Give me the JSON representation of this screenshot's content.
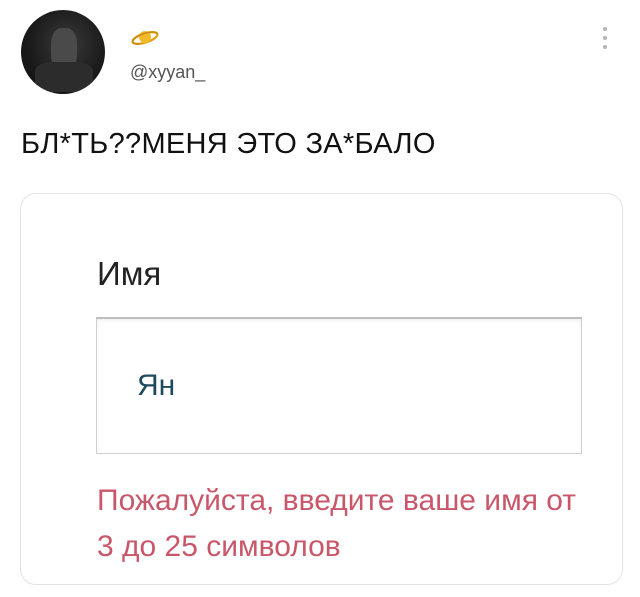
{
  "tweet": {
    "author": {
      "handle": "@xyyan_",
      "avatar_icon": "avatar-photo",
      "badge_icon": "planet-icon"
    },
    "more_icon": "vertical-dots-icon",
    "text": "БЛ*ТЬ??МЕНЯ ЭТО ЗА*БАЛО"
  },
  "form_card": {
    "label": "Имя",
    "input_value": "Ян",
    "error_message": "Пожалуйста, введите ваше имя от 3 до 25 символов",
    "error_color": "#c9576a"
  }
}
